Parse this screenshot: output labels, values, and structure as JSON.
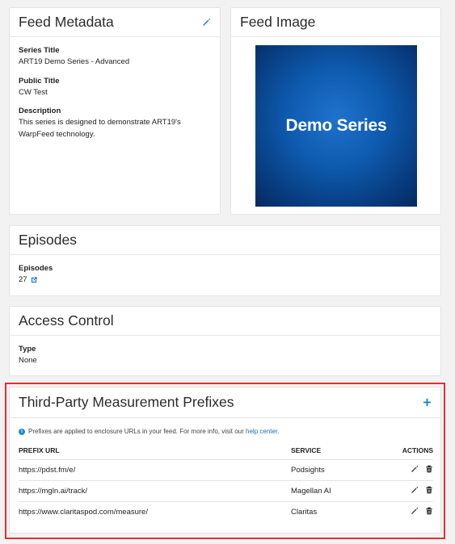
{
  "feed_metadata": {
    "title": "Feed Metadata",
    "series_title_label": "Series Title",
    "series_title_value": "ART19 Demo Series - Advanced",
    "public_title_label": "Public Title",
    "public_title_value": "CW Test",
    "description_label": "Description",
    "description_line1": "This series is designed to demonstrate ART19's",
    "description_line2": "WarpFeed technology."
  },
  "feed_image": {
    "title": "Feed Image",
    "image_text": "Demo Series"
  },
  "episodes": {
    "title": "Episodes",
    "label": "Episodes",
    "value": "27"
  },
  "access_control": {
    "title": "Access Control",
    "type_label": "Type",
    "type_value": "None"
  },
  "prefixes": {
    "title": "Third-Party Measurement Prefixes",
    "add_label": "+",
    "info_text": "Prefixes are applied to enclosure URLs in your feed. For more info, visit our",
    "help_link": "help center",
    "info_suffix": ".",
    "columns": {
      "url": "PREFIX URL",
      "service": "SERVICE",
      "actions": "ACTIONS"
    },
    "rows": [
      {
        "url": "https://pdst.fm/e/",
        "service": "Podsights"
      },
      {
        "url": "https://mgln.ai/track/",
        "service": "Magellan AI"
      },
      {
        "url": "https://www.claritaspod.com/measure/",
        "service": "Claritas"
      }
    ]
  },
  "colors": {
    "accent": "#1a7fc4",
    "highlight": "#e03131",
    "image_background": "#0e5bb0"
  },
  "icons": [
    "pencil-icon",
    "external-link-icon",
    "info-icon",
    "plus-icon",
    "trash-icon"
  ]
}
